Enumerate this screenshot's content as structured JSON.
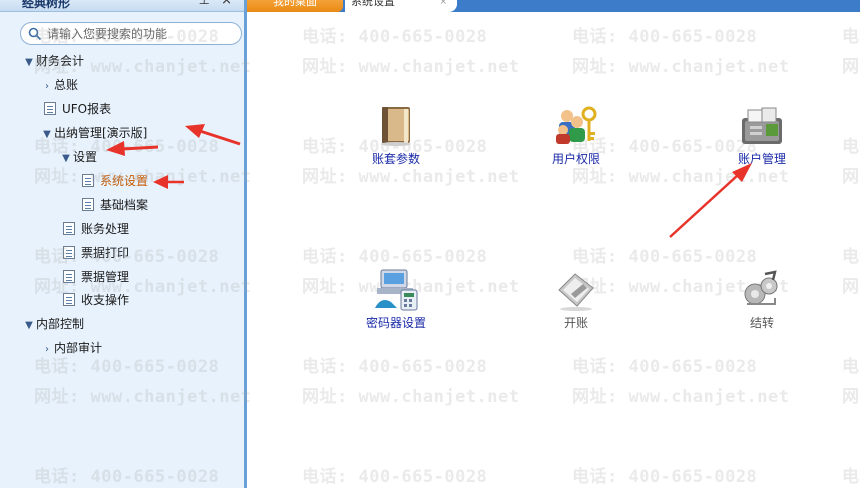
{
  "sidebar": {
    "title": "经典树形",
    "pin_glyph": "⊥",
    "close_glyph": "×",
    "search_placeholder": "请输入您要搜索的功能",
    "items": [
      {
        "label": "财务会计",
        "chevron": "▼"
      },
      {
        "label": "总账",
        "chevron": "›"
      },
      {
        "label": "UFO报表"
      },
      {
        "label": "出纳管理[演示版]",
        "chevron": "▼"
      },
      {
        "label": "设置",
        "chevron": "▼"
      },
      {
        "label": "系统设置"
      },
      {
        "label": "基础档案"
      },
      {
        "label": "账务处理"
      },
      {
        "label": "票据打印"
      },
      {
        "label": "票据管理"
      },
      {
        "label": "收支操作"
      },
      {
        "label": "内部控制",
        "chevron": "▼"
      },
      {
        "label": "内部审计",
        "chevron": "›"
      }
    ]
  },
  "tabs": {
    "home_label": "我的桌面",
    "active_label": "系统设置",
    "close_glyph": "×"
  },
  "watermark": {
    "phone": "电话: 400-665-0028",
    "site": "网址: www.chanjet.net"
  },
  "functions": [
    {
      "label": "账套参数",
      "icon": "book-icon"
    },
    {
      "label": "用户权限",
      "icon": "users-key-icon"
    },
    {
      "label": "账户管理",
      "icon": "account-tools-icon"
    },
    {
      "label": "密码器设置",
      "icon": "password-device-icon"
    },
    {
      "label": "开账",
      "icon": "open-account-icon"
    },
    {
      "label": "结转",
      "icon": "carry-forward-icon"
    }
  ],
  "colors": {
    "accent": "#3d7cc9",
    "home_tab": "#f0961e",
    "arrow": "#e8332a",
    "link_text": "#1a2aa8"
  }
}
